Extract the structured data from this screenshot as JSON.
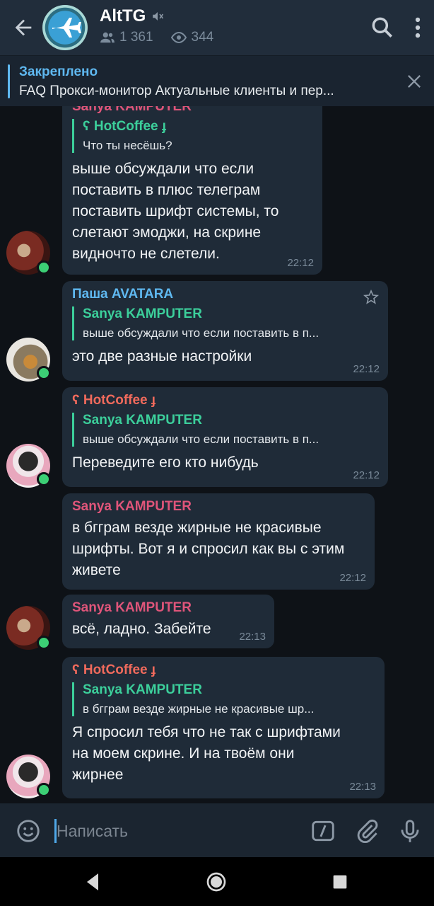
{
  "header": {
    "title": "AltTG",
    "members": "1 361",
    "online_viewers": "344"
  },
  "pinned": {
    "title": "Закреплено",
    "text": "FAQ  Прокси-монитор  Актуальные клиенты и пер..."
  },
  "messages": [
    {
      "sender": "Sanya KAMPUTER",
      "sender_color": "#e0557a",
      "reply_name": "ʕ HotCoffee ɟ",
      "reply_text": "Что ты несёшь?",
      "text": "выше обсуждали что если поставить в плюс телеграм поставить шрифт системы, то слетают эмоджи, на скрине видночто не слетели.",
      "time": "22:12"
    },
    {
      "sender": "Паша AVATARA",
      "sender_color": "#5fb8f0",
      "reply_name": "Sanya KAMPUTER",
      "reply_text": "выше обсуждали что если поставить в п...",
      "text": "это две разные настройки",
      "time": "22:12"
    },
    {
      "sender": "ʕ HotCoffee ɟ",
      "sender_color": "#f06a5c",
      "reply_name": "Sanya KAMPUTER",
      "reply_text": "выше обсуждали что если поставить в п...",
      "text": "Переведите его кто нибудь",
      "time": "22:12"
    },
    {
      "sender": "Sanya KAMPUTER",
      "sender_color": "#e0557a",
      "text": "в бгграм везде жирные не красивые шрифты. Вот я и спросил как вы с этим живете",
      "time": "22:12"
    },
    {
      "sender": "Sanya KAMPUTER",
      "sender_color": "#e0557a",
      "text": "всё, ладно. Забейте",
      "time": "22:13"
    },
    {
      "sender": "ʕ HotCoffee ɟ",
      "sender_color": "#f06a5c",
      "reply_name": "Sanya KAMPUTER",
      "reply_text": "в бгграм везде жирные не красивые шр...",
      "text": "Я спросил тебя что не так с шрифтами на моем скрине. И на твоём они жирнее",
      "time": "22:13"
    }
  ],
  "input": {
    "placeholder": "Написать"
  },
  "icons": {
    "back": "back-arrow-icon",
    "search": "search-icon",
    "menu": "more-vert-icon",
    "close": "close-icon",
    "emoji": "emoji-icon",
    "commands": "bot-commands-icon",
    "attach": "paperclip-icon",
    "mic": "microphone-icon"
  }
}
